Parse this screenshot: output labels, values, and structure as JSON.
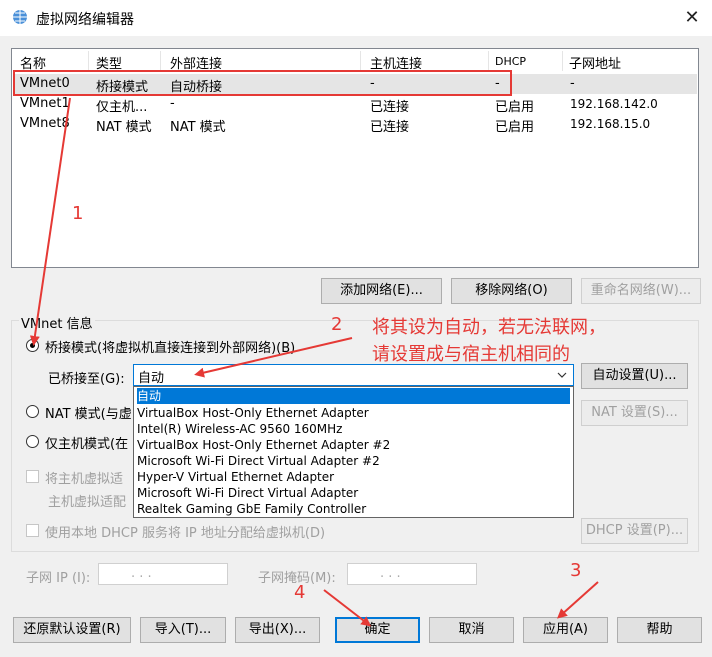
{
  "window": {
    "title": "虚拟网络编辑器",
    "close": "✕"
  },
  "table": {
    "headers": [
      "名称",
      "类型",
      "外部连接",
      "主机连接",
      "DHCP",
      "子网地址"
    ],
    "rows": [
      [
        "VMnet0",
        "桥接模式",
        "自动桥接",
        "-",
        "-",
        "-"
      ],
      [
        "VMnet1",
        "仅主机...",
        "-",
        "已连接",
        "已启用",
        "192.168.142.0"
      ],
      [
        "VMnet8",
        "NAT 模式",
        "NAT 模式",
        "已连接",
        "已启用",
        "192.168.15.0"
      ]
    ]
  },
  "table_buttons": {
    "add": "添加网络(E)...",
    "remove": "移除网络(O)",
    "rename": "重命名网络(W)..."
  },
  "vmnet_info": {
    "group_label": "VMnet 信息",
    "bridge_mode": "桥接模式(将虚拟机直接连接到外部网络)(B)",
    "bridged_to_label": "已桥接至(G):",
    "bridged_to_value": "自动",
    "auto_settings": "自动设置(U)...",
    "nat_mode": "NAT 模式(与虚",
    "nat_settings": "NAT 设置(S)...",
    "host_only": "仅主机模式(在",
    "connect_host_adapter": "将主机虚拟适",
    "host_adapter_name": "主机虚拟适配",
    "dhcp_check": "使用本地 DHCP 服务将 IP 地址分配给虚拟机(D)",
    "dhcp_settings": "DHCP 设置(P)...",
    "subnet_ip_label": "子网 IP (I):",
    "subnet_mask_label": "子网掩码(M):",
    "ip_placeholder": ".   .   ."
  },
  "dropdown_options": [
    "自动",
    "VirtualBox Host-Only Ethernet Adapter",
    "Intel(R) Wireless-AC 9560 160MHz",
    "VirtualBox Host-Only Ethernet Adapter #2",
    "Microsoft Wi-Fi Direct Virtual Adapter #2",
    "Hyper-V Virtual Ethernet Adapter",
    "Microsoft Wi-Fi Direct Virtual Adapter",
    "Realtek Gaming GbE Family Controller"
  ],
  "bottom_buttons": {
    "restore": "还原默认设置(R)",
    "import": "导入(T)...",
    "export": "导出(X)...",
    "ok": "确定",
    "cancel": "取消",
    "apply": "应用(A)",
    "help": "帮助"
  },
  "annotations": {
    "n1": "1",
    "n2": "2",
    "n3": "3",
    "n4": "4",
    "note_line1": "将其设为自动，若无法联网，",
    "note_line2": "请设置成与宿主机相同的",
    "color": "#e53935"
  }
}
